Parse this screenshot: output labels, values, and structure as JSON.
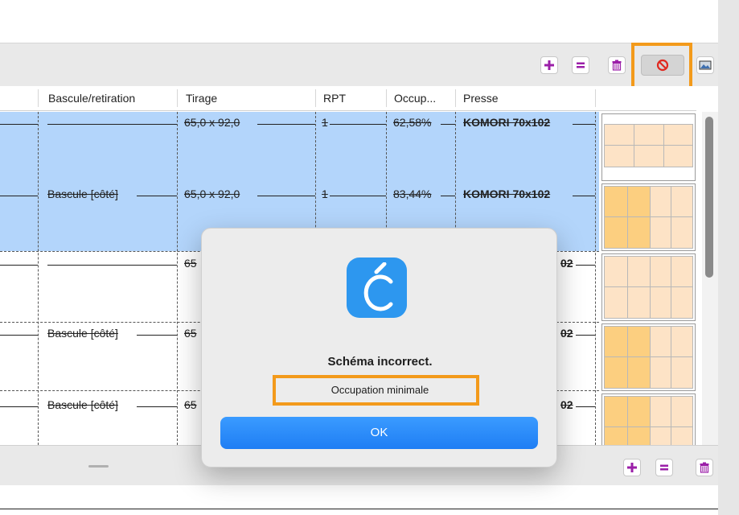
{
  "table": {
    "columns": [
      "Bascule/retiration",
      "Tirage",
      "RPT",
      "Occup...",
      "Presse"
    ],
    "rows": [
      {
        "bascule": "",
        "tirage": "65,0 x 92,0",
        "rpt": "1",
        "occup": "62,58%",
        "presse": "KOMORI 70x102"
      },
      {
        "bascule": "Bascule [côté]",
        "tirage": "65,0 x 92,0",
        "rpt": "1",
        "occup": "83,44%",
        "presse": "KOMORI 70x102"
      },
      {
        "bascule": "",
        "tirage": "65",
        "rpt": "",
        "occup": "",
        "presse": "02"
      },
      {
        "bascule": "Bascule [côté]",
        "tirage": "65",
        "rpt": "",
        "occup": "",
        "presse": "02"
      },
      {
        "bascule": "Bascule [côté]",
        "tirage": "65",
        "rpt": "",
        "occup": "",
        "presse": "02"
      }
    ]
  },
  "toolbar": {
    "icons": [
      "plus-icon",
      "equals-icon",
      "trash-icon",
      "prohibited-icon",
      "image-icon"
    ],
    "colors": {
      "accent": "#9b1fa8",
      "highlight": "#f39a1b",
      "selection": "#b3d5fb"
    }
  },
  "dialog": {
    "title": "Schéma incorrect.",
    "message": "Occupation minimale",
    "ok_label": "OK"
  }
}
